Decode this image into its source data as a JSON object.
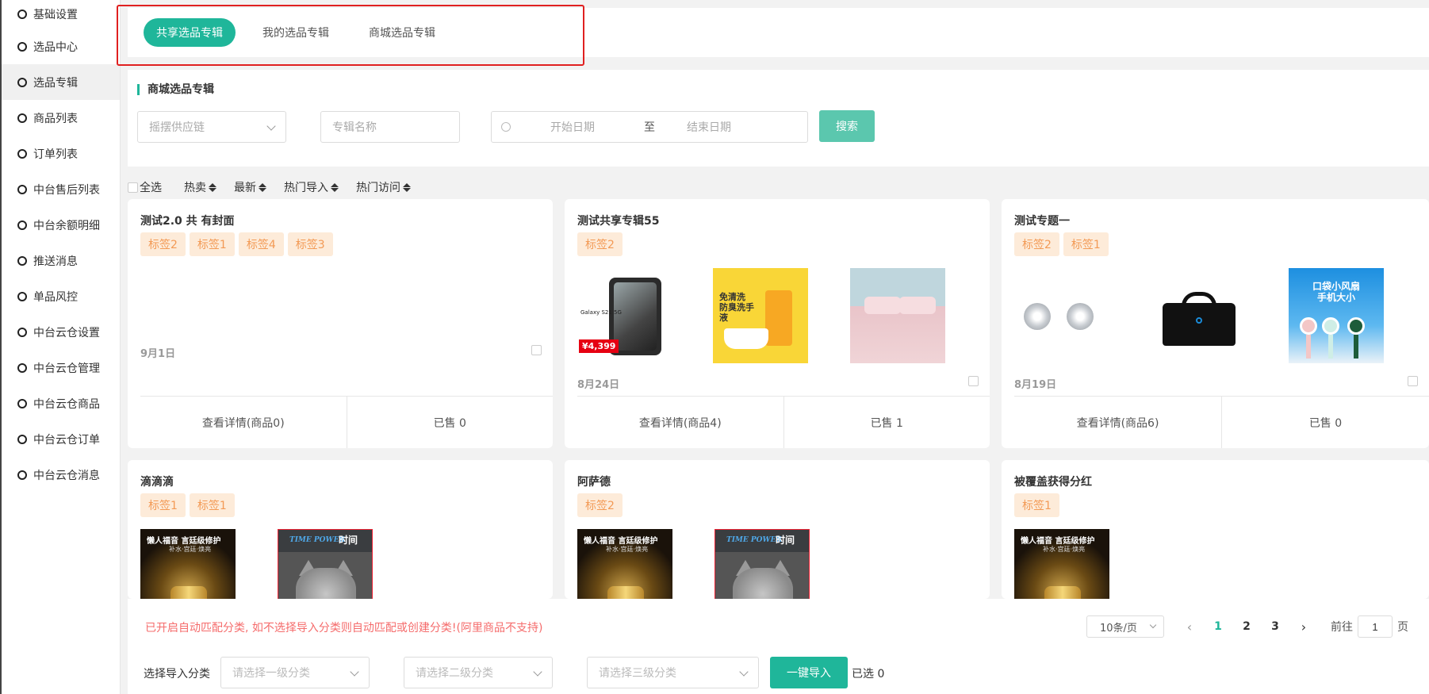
{
  "sidebar": {
    "items": [
      {
        "label": "基础设置"
      },
      {
        "label": "选品中心"
      },
      {
        "label": "选品专辑"
      },
      {
        "label": "商品列表"
      },
      {
        "label": "订单列表"
      },
      {
        "label": "中台售后列表"
      },
      {
        "label": "中台余额明细"
      },
      {
        "label": "推送消息"
      },
      {
        "label": "单品风控"
      },
      {
        "label": "中台云仓设置"
      },
      {
        "label": "中台云仓管理"
      },
      {
        "label": "中台云仓商品"
      },
      {
        "label": "中台云仓订单"
      },
      {
        "label": "中台云仓消息"
      }
    ],
    "active_index": 2
  },
  "tabs": [
    {
      "label": "共享选品专辑",
      "active": true
    },
    {
      "label": "我的选品专辑",
      "active": false
    },
    {
      "label": "商城选品专辑",
      "active": false
    }
  ],
  "filter": {
    "section_title": "商城选品专辑",
    "supply_chain_placeholder": "摇摆供应链",
    "album_name_placeholder": "专辑名称",
    "start_date_placeholder": "开始日期",
    "date_separator": "至",
    "end_date_placeholder": "结束日期",
    "search_label": "搜索"
  },
  "sort_bar": {
    "select_all": "全选",
    "options": [
      "热卖",
      "最新",
      "热门导入",
      "热门访问"
    ]
  },
  "cards": [
    {
      "title": "测试2.0 共 有封面",
      "tags": [
        "标签2",
        "标签1",
        "标签4",
        "标签3"
      ],
      "date": "9月1日",
      "detail": "查看详情(商品0)",
      "sold": "已售 0"
    },
    {
      "title": "测试共享专辑55",
      "tags": [
        "标签2"
      ],
      "date": "8月24日",
      "detail": "查看详情(商品4)",
      "sold": "已售 1"
    },
    {
      "title": "测试专题一",
      "tags": [
        "标签2",
        "标签1"
      ],
      "date": "8月19日",
      "detail": "查看详情(商品6)",
      "sold": "已售 0"
    },
    {
      "title": "滴滴滴",
      "tags": [
        "标签1",
        "标签1"
      ]
    },
    {
      "title": "阿萨德",
      "tags": [
        "标签2"
      ]
    },
    {
      "title": "被覆盖获得分红",
      "tags": [
        "标签1"
      ]
    }
  ],
  "thumb_text": {
    "phone_label": "Galaxy S21 5G",
    "phone_price": "¥4,399",
    "duck_text": "免清洗\n防臭洗手\n液",
    "fan_text": "口袋小风扇\n手机大小",
    "gold_text": "懒人福音 言廷级修护",
    "gold_sub": "补水·宫廷·焕亮",
    "cat_brand": "TIME POWER",
    "cat_brand_cn": "时间"
  },
  "bottom": {
    "notice": "已开启自动匹配分类, 如不选择导入分类则自动匹配或创建分类!(阿里商品不支持)",
    "page_size": "10条/页",
    "pages": [
      "1",
      "2",
      "3"
    ],
    "current_page": "1",
    "goto_prefix": "前往",
    "goto_value": "1",
    "goto_suffix": "页",
    "import_label": "选择导入分类",
    "level1_placeholder": "请选择一级分类",
    "level2_placeholder": "请选择二级分类",
    "level3_placeholder": "请选择三级分类",
    "import_button": "一键导入",
    "selected": "已选 0"
  },
  "colors": {
    "accent": "#1fb69a",
    "tag_bg": "#fdebd9",
    "tag_text": "#f39a55",
    "notice": "#f56c6c",
    "highlight_border": "#e02020"
  }
}
